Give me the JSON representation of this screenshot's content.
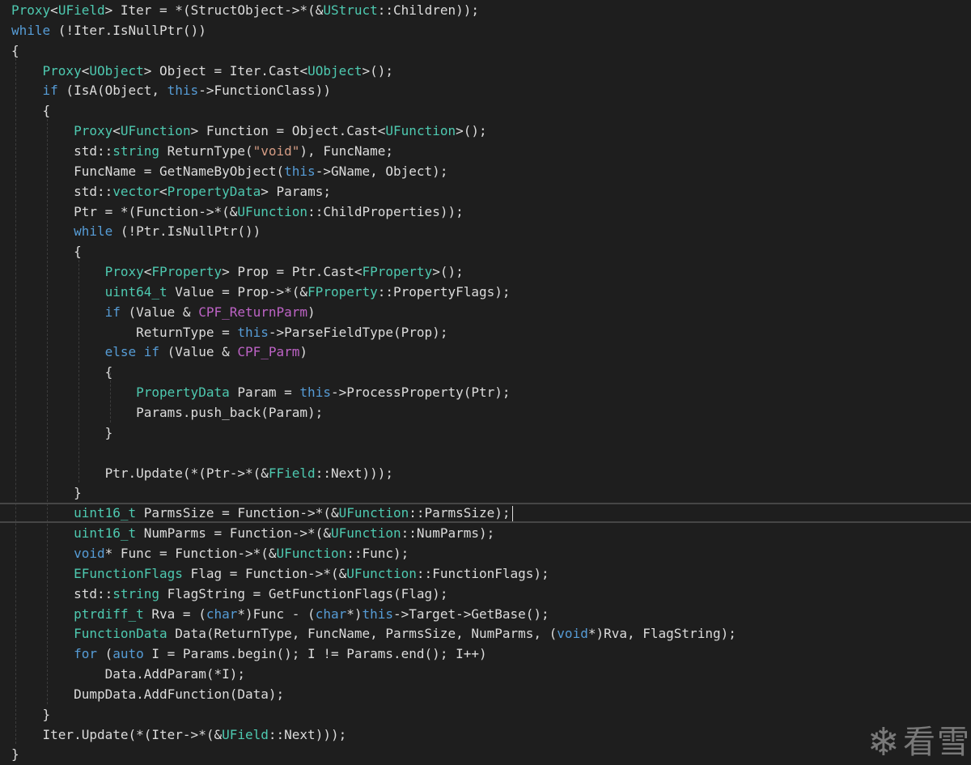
{
  "code": {
    "lines": [
      [
        {
          "t": "Proxy",
          "c": "ty"
        },
        {
          "t": "<",
          "c": "tx"
        },
        {
          "t": "UField",
          "c": "ty"
        },
        {
          "t": "> Iter = *(StructObject->*(&",
          "c": "tx"
        },
        {
          "t": "UStruct",
          "c": "ty"
        },
        {
          "t": "::Children));",
          "c": "tx"
        }
      ],
      [
        {
          "t": "while",
          "c": "kw"
        },
        {
          "t": " (!Iter.IsNullPtr())",
          "c": "tx"
        }
      ],
      [
        {
          "t": "{",
          "c": "tx"
        }
      ],
      [
        {
          "t": "    ",
          "c": "tx"
        },
        {
          "t": "Proxy",
          "c": "ty"
        },
        {
          "t": "<",
          "c": "tx"
        },
        {
          "t": "UObject",
          "c": "ty"
        },
        {
          "t": "> Object = Iter.Cast<",
          "c": "tx"
        },
        {
          "t": "UObject",
          "c": "ty"
        },
        {
          "t": ">();",
          "c": "tx"
        }
      ],
      [
        {
          "t": "    ",
          "c": "tx"
        },
        {
          "t": "if",
          "c": "kw"
        },
        {
          "t": " (IsA(Object, ",
          "c": "tx"
        },
        {
          "t": "this",
          "c": "kw"
        },
        {
          "t": "->FunctionClass))",
          "c": "tx"
        }
      ],
      [
        {
          "t": "    {",
          "c": "tx"
        }
      ],
      [
        {
          "t": "        ",
          "c": "tx"
        },
        {
          "t": "Proxy",
          "c": "ty"
        },
        {
          "t": "<",
          "c": "tx"
        },
        {
          "t": "UFunction",
          "c": "ty"
        },
        {
          "t": "> Function = Object.Cast<",
          "c": "tx"
        },
        {
          "t": "UFunction",
          "c": "ty"
        },
        {
          "t": ">();",
          "c": "tx"
        }
      ],
      [
        {
          "t": "        std::",
          "c": "tx"
        },
        {
          "t": "string",
          "c": "ty"
        },
        {
          "t": " ReturnType(",
          "c": "tx"
        },
        {
          "t": "\"void\"",
          "c": "str"
        },
        {
          "t": "), FuncName;",
          "c": "tx"
        }
      ],
      [
        {
          "t": "        FuncName = GetNameByObject(",
          "c": "tx"
        },
        {
          "t": "this",
          "c": "kw"
        },
        {
          "t": "->GName, Object);",
          "c": "tx"
        }
      ],
      [
        {
          "t": "        std::",
          "c": "tx"
        },
        {
          "t": "vector",
          "c": "ty"
        },
        {
          "t": "<",
          "c": "tx"
        },
        {
          "t": "PropertyData",
          "c": "ty"
        },
        {
          "t": "> Params;",
          "c": "tx"
        }
      ],
      [
        {
          "t": "        Ptr = *(Function->*(&",
          "c": "tx"
        },
        {
          "t": "UFunction",
          "c": "ty"
        },
        {
          "t": "::ChildProperties));",
          "c": "tx"
        }
      ],
      [
        {
          "t": "        ",
          "c": "tx"
        },
        {
          "t": "while",
          "c": "kw"
        },
        {
          "t": " (!Ptr.IsNullPtr())",
          "c": "tx"
        }
      ],
      [
        {
          "t": "        {",
          "c": "tx"
        }
      ],
      [
        {
          "t": "            ",
          "c": "tx"
        },
        {
          "t": "Proxy",
          "c": "ty"
        },
        {
          "t": "<",
          "c": "tx"
        },
        {
          "t": "FProperty",
          "c": "ty"
        },
        {
          "t": "> Prop = Ptr.Cast<",
          "c": "tx"
        },
        {
          "t": "FProperty",
          "c": "ty"
        },
        {
          "t": ">();",
          "c": "tx"
        }
      ],
      [
        {
          "t": "            ",
          "c": "tx"
        },
        {
          "t": "uint64_t",
          "c": "ty"
        },
        {
          "t": " Value = Prop->*(&",
          "c": "tx"
        },
        {
          "t": "FProperty",
          "c": "ty"
        },
        {
          "t": "::PropertyFlags);",
          "c": "tx"
        }
      ],
      [
        {
          "t": "            ",
          "c": "tx"
        },
        {
          "t": "if",
          "c": "kw"
        },
        {
          "t": " (Value & ",
          "c": "tx"
        },
        {
          "t": "CPF_ReturnParm",
          "c": "mac"
        },
        {
          "t": ")",
          "c": "tx"
        }
      ],
      [
        {
          "t": "                ReturnType = ",
          "c": "tx"
        },
        {
          "t": "this",
          "c": "kw"
        },
        {
          "t": "->ParseFieldType(Prop);",
          "c": "tx"
        }
      ],
      [
        {
          "t": "            ",
          "c": "tx"
        },
        {
          "t": "else if",
          "c": "kw"
        },
        {
          "t": " (Value & ",
          "c": "tx"
        },
        {
          "t": "CPF_Parm",
          "c": "mac"
        },
        {
          "t": ")",
          "c": "tx"
        }
      ],
      [
        {
          "t": "            {",
          "c": "tx"
        }
      ],
      [
        {
          "t": "                ",
          "c": "tx"
        },
        {
          "t": "PropertyData",
          "c": "ty"
        },
        {
          "t": " Param = ",
          "c": "tx"
        },
        {
          "t": "this",
          "c": "kw"
        },
        {
          "t": "->ProcessProperty(Ptr);",
          "c": "tx"
        }
      ],
      [
        {
          "t": "                Params.push_back(Param);",
          "c": "tx"
        }
      ],
      [
        {
          "t": "            }",
          "c": "tx"
        }
      ],
      [],
      [
        {
          "t": "            Ptr.Update(*(Ptr->*(&",
          "c": "tx"
        },
        {
          "t": "FField",
          "c": "ty"
        },
        {
          "t": "::Next)));",
          "c": "tx"
        }
      ],
      [
        {
          "t": "        }",
          "c": "tx"
        }
      ],
      [
        {
          "t": "        ",
          "c": "tx"
        },
        {
          "t": "uint16_t",
          "c": "ty"
        },
        {
          "t": " ParmsSize = Function->*(&",
          "c": "tx"
        },
        {
          "t": "UFunction",
          "c": "ty"
        },
        {
          "t": "::ParmsSize);",
          "c": "tx"
        }
      ],
      [
        {
          "t": "        ",
          "c": "tx"
        },
        {
          "t": "uint16_t",
          "c": "ty"
        },
        {
          "t": " NumParms = Function->*(&",
          "c": "tx"
        },
        {
          "t": "UFunction",
          "c": "ty"
        },
        {
          "t": "::NumParms);",
          "c": "tx"
        }
      ],
      [
        {
          "t": "        ",
          "c": "tx"
        },
        {
          "t": "void",
          "c": "kw"
        },
        {
          "t": "* Func = Function->*(&",
          "c": "tx"
        },
        {
          "t": "UFunction",
          "c": "ty"
        },
        {
          "t": "::Func);",
          "c": "tx"
        }
      ],
      [
        {
          "t": "        ",
          "c": "tx"
        },
        {
          "t": "EFunctionFlags",
          "c": "ty"
        },
        {
          "t": " Flag = Function->*(&",
          "c": "tx"
        },
        {
          "t": "UFunction",
          "c": "ty"
        },
        {
          "t": "::FunctionFlags);",
          "c": "tx"
        }
      ],
      [
        {
          "t": "        std::",
          "c": "tx"
        },
        {
          "t": "string",
          "c": "ty"
        },
        {
          "t": " FlagString = GetFunctionFlags(Flag);",
          "c": "tx"
        }
      ],
      [
        {
          "t": "        ",
          "c": "tx"
        },
        {
          "t": "ptrdiff_t",
          "c": "ty"
        },
        {
          "t": " Rva = (",
          "c": "tx"
        },
        {
          "t": "char",
          "c": "kw"
        },
        {
          "t": "*)Func - (",
          "c": "tx"
        },
        {
          "t": "char",
          "c": "kw"
        },
        {
          "t": "*)",
          "c": "tx"
        },
        {
          "t": "this",
          "c": "kw"
        },
        {
          "t": "->Target->GetBase();",
          "c": "tx"
        }
      ],
      [
        {
          "t": "        ",
          "c": "tx"
        },
        {
          "t": "FunctionData",
          "c": "ty"
        },
        {
          "t": " Data(ReturnType, FuncName, ParmsSize, NumParms, (",
          "c": "tx"
        },
        {
          "t": "void",
          "c": "kw"
        },
        {
          "t": "*)Rva, FlagString);",
          "c": "tx"
        }
      ],
      [
        {
          "t": "        ",
          "c": "tx"
        },
        {
          "t": "for",
          "c": "kw"
        },
        {
          "t": " (",
          "c": "tx"
        },
        {
          "t": "auto",
          "c": "kw"
        },
        {
          "t": " I = Params.begin(); I != Params.end(); I++)",
          "c": "tx"
        }
      ],
      [
        {
          "t": "            Data.AddParam(*I);",
          "c": "tx"
        }
      ],
      [
        {
          "t": "        DumpData.AddFunction(Data);",
          "c": "tx"
        }
      ],
      [
        {
          "t": "    }",
          "c": "tx"
        }
      ],
      [
        {
          "t": "    Iter.Update(*(Iter->*(&",
          "c": "tx"
        },
        {
          "t": "UField",
          "c": "ty"
        },
        {
          "t": "::Next)));",
          "c": "tx"
        }
      ],
      [
        {
          "t": "}",
          "c": "tx"
        }
      ]
    ],
    "current_line": 25
  },
  "watermark": {
    "icon": "snowflake-icon",
    "glyph": "❄",
    "text": "看雪"
  }
}
